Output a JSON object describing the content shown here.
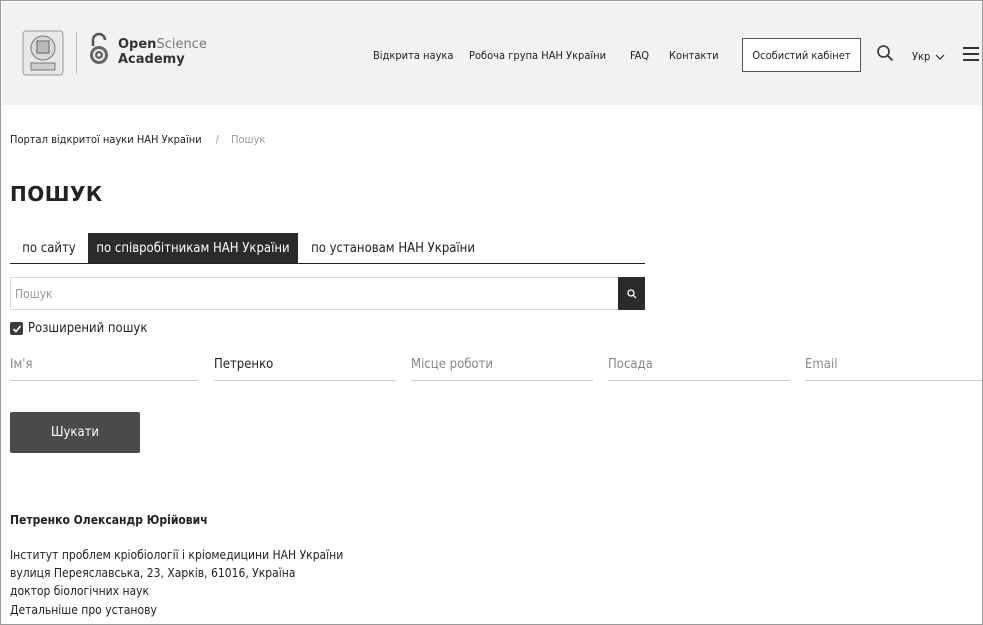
{
  "header": {
    "brand_open": "Open",
    "brand_science": "Science",
    "brand_academy": "Academy",
    "nav": [
      "Відкрита наука",
      "Робоча група НАН України",
      "FAQ",
      "Контакти"
    ],
    "cabinet_label": "Особистий кабінет",
    "language": "Укр",
    "icons": [
      "nas-emblem",
      "open-lock-icon",
      "search-icon",
      "chevron-down-icon",
      "menu-icon"
    ]
  },
  "breadcrumb": {
    "home": "Портал відкритої науки НАН України",
    "separator": "/",
    "current": "Пошук"
  },
  "page_title": "ПОШУК",
  "tabs": [
    "по сайту",
    "по співробітникам НАН України",
    "по установам НАН України"
  ],
  "active_tab": 1,
  "search": {
    "placeholder": "Пошук",
    "value": ""
  },
  "advanced": {
    "label": "Розширений пошук",
    "checked": true
  },
  "fields": {
    "name_placeholder": "Ім'я",
    "surname_value": "Петренко",
    "workplace_placeholder": "Місце роботи",
    "position_placeholder": "Посада",
    "email_placeholder": "Email"
  },
  "submit_label": "Шукати",
  "result": {
    "name": "Петренко Олександр Юрійович",
    "institution": "Інститут проблем кріобіології і кріомедицини НАН України",
    "address": "вулиця Переяславська, 23, Харків, 61016, Україна",
    "degree": "доктор біологічних наук",
    "details_link": "Детальніше про установу"
  },
  "colors": {
    "dark": "#2b2b2b",
    "header_bg": "#f2f2f2",
    "button": "#4a4a4a"
  }
}
